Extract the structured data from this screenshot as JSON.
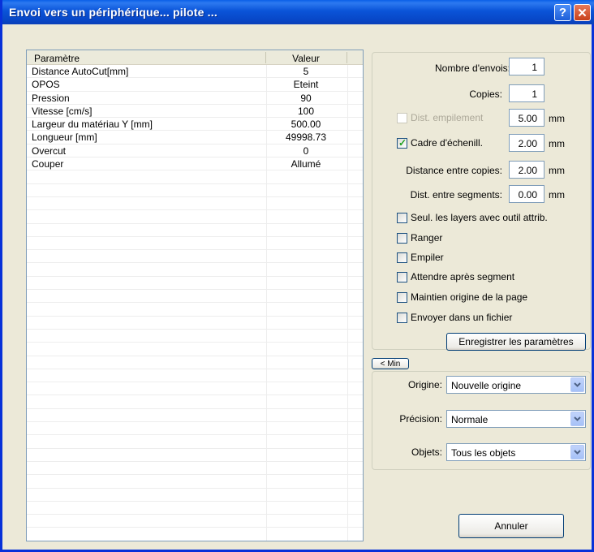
{
  "window": {
    "title": "Envoi vers un périphérique... pilote ...",
    "help": "?",
    "close": "✕"
  },
  "params": {
    "header_param": "Paramètre",
    "header_value": "Valeur",
    "rows": [
      {
        "param": "Distance AutoCut[mm]",
        "value": "5"
      },
      {
        "param": "OPOS",
        "value": "Eteint"
      },
      {
        "param": "Pression",
        "value": "90"
      },
      {
        "param": "Vitesse [cm/s]",
        "value": "100"
      },
      {
        "param": "Largeur du matériau Y  [mm]",
        "value": "500.00"
      },
      {
        "param": "Longueur [mm]",
        "value": "49998.73"
      },
      {
        "param": "Overcut",
        "value": "0"
      },
      {
        "param": "Couper",
        "value": "Allumé"
      }
    ]
  },
  "options": {
    "nb_envois_label": "Nombre d'envois:",
    "nb_envois": "1",
    "copies_label": "Copies:",
    "copies": "1",
    "dist_empilement_label": "Dist. empilement",
    "dist_empilement": "5.00",
    "cadre_label": "Cadre d'échenill.",
    "cadre": "2.00",
    "dist_copies_label": "Distance entre copies:",
    "dist_copies": "2.00",
    "dist_segments_label": "Dist. entre segments:",
    "dist_segments": "0.00",
    "unit": "mm",
    "cb_layers": "Seul. les layers avec outil attrib.",
    "cb_ranger": "Ranger",
    "cb_empiler": "Empiler",
    "cb_attendre": "Attendre après segment",
    "cb_maintien": "Maintien origine de la page",
    "cb_fichier": "Envoyer dans un fichier",
    "save_button": "Enregistrer les paramètres",
    "min_button": "< Min"
  },
  "settings": {
    "origine_label": "Origine:",
    "origine": "Nouvelle origine",
    "precision_label": "Précision:",
    "precision": "Normale",
    "objets_label": "Objets:",
    "objets": "Tous les objets"
  },
  "cancel_button": "Annuler"
}
